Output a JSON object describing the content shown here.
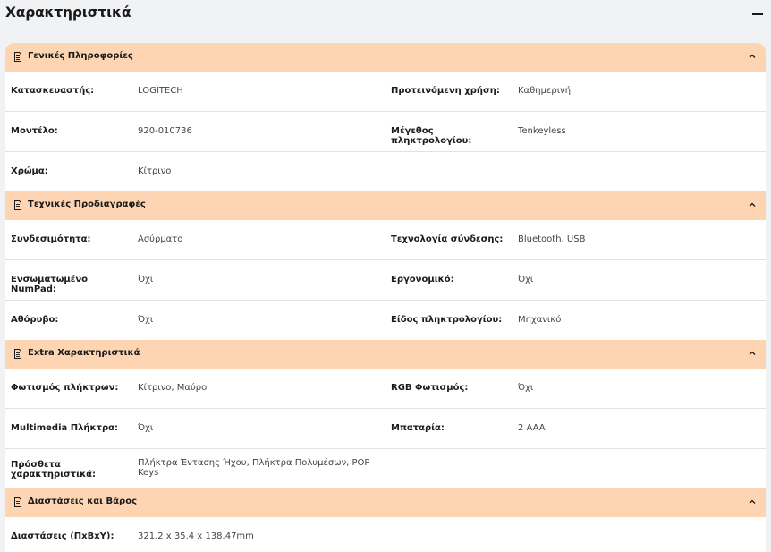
{
  "header": {
    "title": "Χαρακτηριστικά"
  },
  "sections": [
    {
      "title": "Γενικές Πληροφορίες",
      "rows": [
        {
          "l1": "Κατασκευαστής:",
          "v1": "LOGITECH",
          "l2": "Προτεινόμενη χρήση:",
          "v2": "Καθημερινή"
        },
        {
          "l1": "Μοντέλο:",
          "v1": "920-010736",
          "l2": "Μέγεθος πληκτρολογίου:",
          "v2": "Tenkeyless"
        },
        {
          "l1": "Χρώμα:",
          "v1": "Κίτρινο",
          "l2": "",
          "v2": ""
        }
      ]
    },
    {
      "title": "Τεχνικές Προδιαγραφές",
      "rows": [
        {
          "l1": "Συνδεσιμότητα:",
          "v1": "Ασύρματο",
          "l2": "Τεχνολογία σύνδεσης:",
          "v2": "Bluetooth, USB"
        },
        {
          "l1": "Ενσωματωμένο NumPad:",
          "v1": "Όχι",
          "l2": "Εργονομικό:",
          "v2": "Όχι"
        },
        {
          "l1": "Αθόρυβο:",
          "v1": "Όχι",
          "l2": "Είδος πληκτρολογίου:",
          "v2": "Μηχανικό"
        }
      ]
    },
    {
      "title": "Extra Χαρακτηριστικά",
      "rows": [
        {
          "l1": "Φωτισμός πλήκτρων:",
          "v1": "Κίτρινο, Μαύρο",
          "l2": "RGB Φωτισμός:",
          "v2": "Όχι"
        },
        {
          "l1": "Multimedia Πλήκτρα:",
          "v1": "Όχι",
          "l2": "Μπαταρία:",
          "v2": "2 AAA"
        },
        {
          "l1": "Πρόσθετα χαρακτηριστικά:",
          "v1": "Πλήκτρα Έντασης Ήχου, Πλήκτρα Πολυμέσων, POP Keys",
          "l2": "",
          "v2": ""
        }
      ]
    },
    {
      "title": "Διαστάσεις και Βάρος",
      "rows": [
        {
          "l1": "Διαστάσεις (ΠxΒxΥ):",
          "v1": "321.2 x 35.4 x 138.47mm",
          "l2": "",
          "v2": ""
        }
      ]
    }
  ],
  "icons": {
    "section": "document-icon",
    "toggle": "chevron-up-icon",
    "collapse_all": "minus-icon"
  },
  "colors": {
    "section_bg": "#fdd5b3",
    "page_bg": "#f1f2f4",
    "card_bg": "#ffffff"
  }
}
